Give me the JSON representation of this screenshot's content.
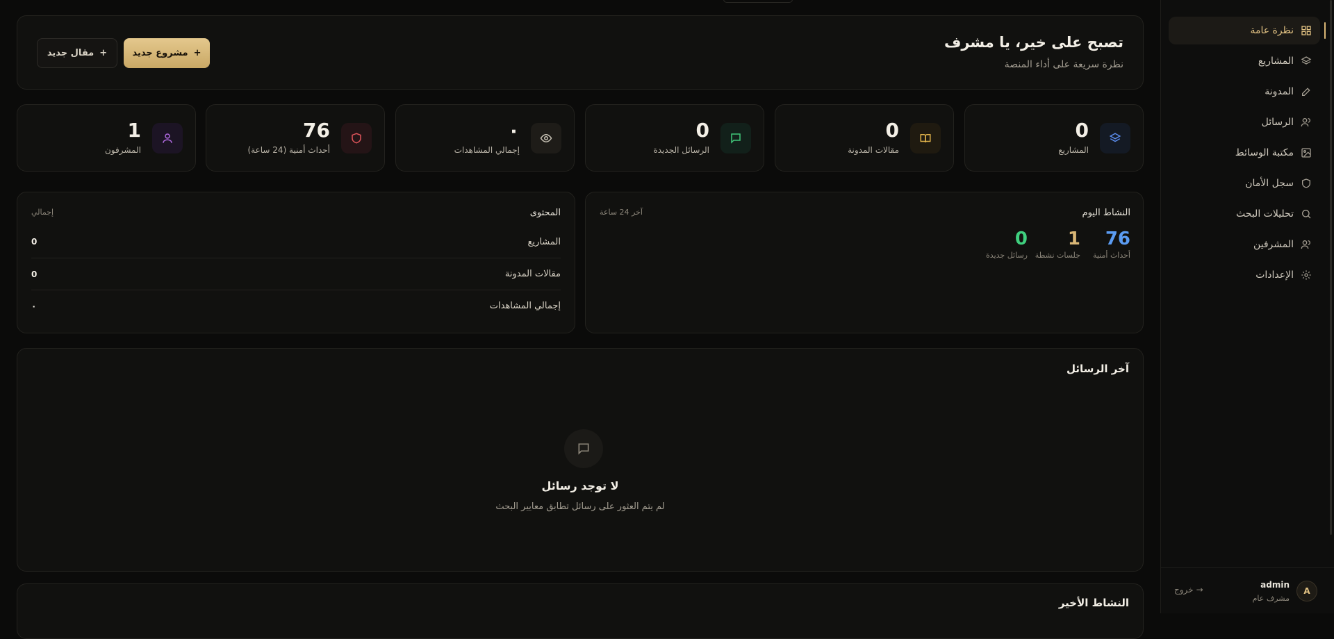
{
  "sidebar": {
    "items": [
      {
        "label": "نظرة عامة",
        "icon": "grid-icon"
      },
      {
        "label": "المشاريع",
        "icon": "layers-icon"
      },
      {
        "label": "المدونة",
        "icon": "pen-icon"
      },
      {
        "label": "الرسائل",
        "icon": "users-icon"
      },
      {
        "label": "مكتبة الوسائط",
        "icon": "image-icon"
      },
      {
        "label": "سجل الأمان",
        "icon": "shield-icon"
      },
      {
        "label": "تحليلات البحث",
        "icon": "search-icon"
      },
      {
        "label": "المشرفين",
        "icon": "users-icon"
      },
      {
        "label": "الإعدادات",
        "icon": "gear-icon"
      }
    ],
    "user": {
      "initial": "A",
      "name": "admin",
      "role": "مشرف عام",
      "logout": "خروج"
    }
  },
  "header": {
    "title": "تصبح على خير، يا مشرف",
    "subtitle": "نظرة سريعة على أداء المنصة",
    "new_project": "مشروع جديد",
    "new_article": "مقال جديد"
  },
  "stats": [
    {
      "value": "0",
      "label": "المشاريع",
      "color": "#5b8def",
      "bg": "#141a24"
    },
    {
      "value": "0",
      "label": "مقالات المدونة",
      "color": "#e0b24a",
      "bg": "#1f1a10"
    },
    {
      "value": "0",
      "label": "الرسائل الجديدة",
      "color": "#41c77a",
      "bg": "#12201a"
    },
    {
      "value": "٠",
      "label": "إجمالي المشاهدات",
      "color": "#c8c2b5",
      "bg": "#1e1c18"
    },
    {
      "value": "76",
      "label": "أحداث أمنية (24 ساعة)",
      "color": "#e0555b",
      "bg": "#241416"
    },
    {
      "value": "1",
      "label": "المشرفون",
      "color": "#b06ae0",
      "bg": "#1c1424"
    }
  ],
  "activity": {
    "title": "النشاط اليوم",
    "period": "آخر 24 ساعة",
    "metrics": [
      {
        "value": "76",
        "label": "أحداث أمنية",
        "color": "#5b9cf2"
      },
      {
        "value": "1",
        "label": "جلسات نشطة",
        "color": "#d9b675"
      },
      {
        "value": "0",
        "label": "رسائل جديدة",
        "color": "#3fcf7e"
      }
    ]
  },
  "content": {
    "title": "المحتوى",
    "total": "إجمالي",
    "rows": [
      {
        "label": "المشاريع",
        "value": "0"
      },
      {
        "label": "مقالات المدونة",
        "value": "0"
      },
      {
        "label": "إجمالي المشاهدات",
        "value": "٠"
      }
    ]
  },
  "messages": {
    "title": "آخر الرسائل",
    "empty_title": "لا توجد رسائل",
    "empty_sub": "لم يتم العثور على رسائل تطابق معايير البحث"
  },
  "recent": {
    "title": "النشاط الأخير"
  }
}
